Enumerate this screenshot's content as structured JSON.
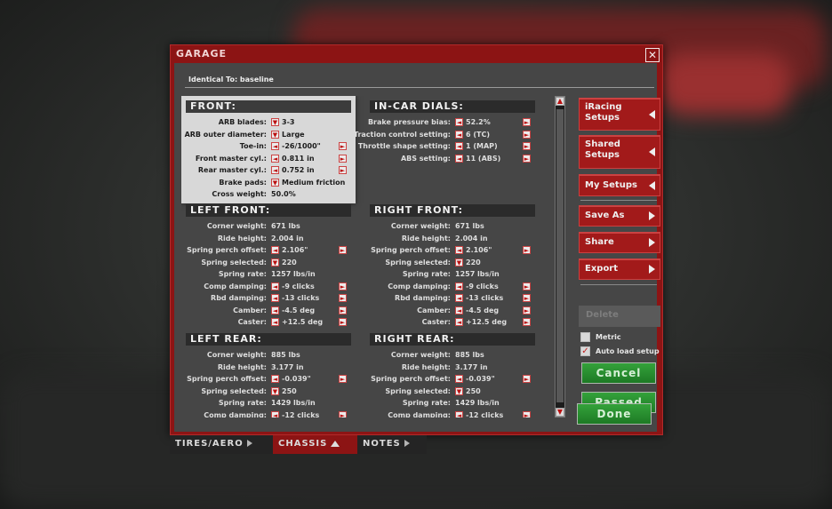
{
  "window": {
    "title": "GARAGE",
    "identical_to": "Identical To: baseline"
  },
  "icons": {
    "close": "close-icon",
    "left": "arrow-left-icon",
    "right": "arrow-right-icon",
    "dropdown": "dropdown-icon"
  },
  "sections": {
    "front": {
      "title": "FRONT:",
      "rows": [
        {
          "label": "ARB blades:",
          "value": "3-3",
          "ctl": "dd"
        },
        {
          "label": "ARB outer diameter:",
          "value": "Large",
          "ctl": "dd"
        },
        {
          "label": "Toe-in:",
          "value": "-26/1000\"",
          "ctl": "lr"
        },
        {
          "label": "Front master cyl.:",
          "value": "0.811 in",
          "ctl": "lr"
        },
        {
          "label": "Rear master cyl.:",
          "value": "0.752 in",
          "ctl": "lr"
        },
        {
          "label": "Brake pads:",
          "value": "Medium friction",
          "ctl": "dd"
        },
        {
          "label": "Cross weight:",
          "value": "50.0%",
          "ctl": "plain"
        }
      ]
    },
    "incar": {
      "title": "IN-CAR DIALS:",
      "rows": [
        {
          "label": "Brake pressure bias:",
          "value": "52.2%",
          "ctl": "lr"
        },
        {
          "label": "Traction control setting:",
          "value": "6 (TC)",
          "ctl": "lr"
        },
        {
          "label": "Throttle shape setting:",
          "value": "1 (MAP)",
          "ctl": "lr"
        },
        {
          "label": "ABS setting:",
          "value": "11 (ABS)",
          "ctl": "lr"
        }
      ]
    },
    "left_front": {
      "title": "LEFT FRONT:",
      "rows": [
        {
          "label": "Corner weight:",
          "value": "671 lbs",
          "ctl": "plain"
        },
        {
          "label": "Ride height:",
          "value": "2.004 in",
          "ctl": "plain"
        },
        {
          "label": "Spring perch offset:",
          "value": "2.106\"",
          "ctl": "lr"
        },
        {
          "label": "Spring selected:",
          "value": "220",
          "ctl": "dd"
        },
        {
          "label": "Spring rate:",
          "value": "1257 lbs/in",
          "ctl": "plain"
        },
        {
          "label": "Comp damping:",
          "value": "-9 clicks",
          "ctl": "lr"
        },
        {
          "label": "Rbd damping:",
          "value": "-13 clicks",
          "ctl": "lr"
        },
        {
          "label": "Camber:",
          "value": "-4.5 deg",
          "ctl": "lr"
        },
        {
          "label": "Caster:",
          "value": "+12.5 deg",
          "ctl": "lr"
        }
      ]
    },
    "right_front": {
      "title": "RIGHT FRONT:",
      "rows": [
        {
          "label": "Corner weight:",
          "value": "671 lbs",
          "ctl": "plain"
        },
        {
          "label": "Ride height:",
          "value": "2.004 in",
          "ctl": "plain"
        },
        {
          "label": "Spring perch offset:",
          "value": "2.106\"",
          "ctl": "lr"
        },
        {
          "label": "Spring selected:",
          "value": "220",
          "ctl": "dd"
        },
        {
          "label": "Spring rate:",
          "value": "1257 lbs/in",
          "ctl": "plain"
        },
        {
          "label": "Comp damping:",
          "value": "-9 clicks",
          "ctl": "lr"
        },
        {
          "label": "Rbd damping:",
          "value": "-13 clicks",
          "ctl": "lr"
        },
        {
          "label": "Camber:",
          "value": "-4.5 deg",
          "ctl": "lr"
        },
        {
          "label": "Caster:",
          "value": "+12.5 deg",
          "ctl": "lr"
        }
      ]
    },
    "left_rear": {
      "title": "LEFT REAR:",
      "rows": [
        {
          "label": "Corner weight:",
          "value": "885 lbs",
          "ctl": "plain"
        },
        {
          "label": "Ride height:",
          "value": "3.177 in",
          "ctl": "plain"
        },
        {
          "label": "Spring perch offset:",
          "value": "-0.039\"",
          "ctl": "lr"
        },
        {
          "label": "Spring selected:",
          "value": "250",
          "ctl": "dd"
        },
        {
          "label": "Spring rate:",
          "value": "1429 lbs/in",
          "ctl": "plain"
        },
        {
          "label": "Comp damping:",
          "value": "-12 clicks",
          "ctl": "lr"
        }
      ]
    },
    "right_rear": {
      "title": "RIGHT REAR:",
      "rows": [
        {
          "label": "Corner weight:",
          "value": "885 lbs",
          "ctl": "plain"
        },
        {
          "label": "Ride height:",
          "value": "3.177 in",
          "ctl": "plain"
        },
        {
          "label": "Spring perch offset:",
          "value": "-0.039\"",
          "ctl": "lr"
        },
        {
          "label": "Spring selected:",
          "value": "250",
          "ctl": "dd"
        },
        {
          "label": "Spring rate:",
          "value": "1429 lbs/in",
          "ctl": "plain"
        },
        {
          "label": "Comp damping:",
          "value": "-12 clicks",
          "ctl": "lr"
        }
      ]
    }
  },
  "side": {
    "iracing": "iRacing Setups",
    "shared": "Shared Setups",
    "mysetups": "My Setups",
    "saveas": "Save As",
    "share": "Share",
    "export": "Export",
    "delete": "Delete",
    "metric": "Metric",
    "autoload": "Auto load setup",
    "cancel": "Cancel",
    "passed": "Passed",
    "done": "Done"
  },
  "checkboxes": {
    "metric": false,
    "autoload": true
  },
  "tabs": [
    {
      "label": "TIRES/AERO",
      "active": false
    },
    {
      "label": "CHASSIS",
      "active": true
    },
    {
      "label": "NOTES",
      "active": false
    }
  ],
  "colors": {
    "dialog_red": "#8c1414",
    "button_red": "#a21a1a",
    "green": "#2a8f30",
    "panel_gray": "#464646"
  }
}
